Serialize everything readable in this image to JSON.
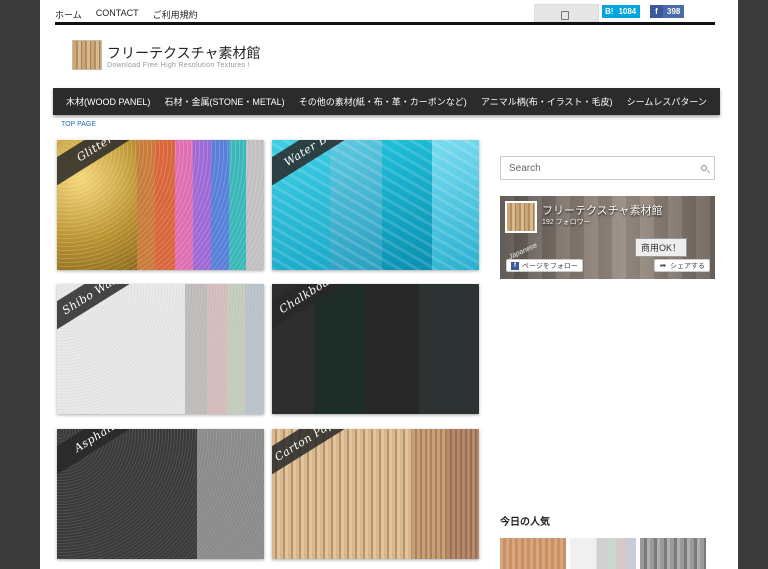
{
  "top_nav": {
    "home": "ホーム",
    "contact": "CONTACT",
    "terms": "ご利用規約"
  },
  "share": {
    "hatena_logo": "B!",
    "hatena_count": "1084",
    "facebook_logo": "f",
    "facebook_count": "398"
  },
  "header": {
    "title": "フリーテクスチャ素材館",
    "subtitle": "Download Free High Resolution Textures !"
  },
  "main_nav": [
    "木材(WOOD PANEL)",
    "石材・金属(STONE・METAL)",
    "その他の素材(紙・布・革・カーボンなど)",
    "アニマル柄(布・イラスト・毛皮)",
    "シームレスパターン"
  ],
  "breadcrumb": "TOP PAGE",
  "tiles": [
    {
      "label": "Glitter Pattern set"
    },
    {
      "label": "Water BG Pattern set"
    },
    {
      "label": "Shibo Washi Pattern set"
    },
    {
      "label": "Chalkboard Pattern set"
    },
    {
      "label": "Asphalt Pattern set"
    },
    {
      "label": "Carton Paper Pattern set"
    }
  ],
  "sidebar": {
    "search_placeholder": "Search",
    "fb_widget": {
      "page_name": "フリーテクスチャ素材館",
      "followers": "192 フォロワー",
      "follow_label": "ページをフォロー",
      "share_label": "シェアする",
      "stamp": "商用OK！",
      "tag": "Japanese"
    },
    "popular_title": "今日の人気"
  },
  "colors": {
    "nav_bg": "#2b2b2b",
    "link": "#1e73be",
    "hatena": "#00a4de",
    "facebook": "#3b5998"
  }
}
